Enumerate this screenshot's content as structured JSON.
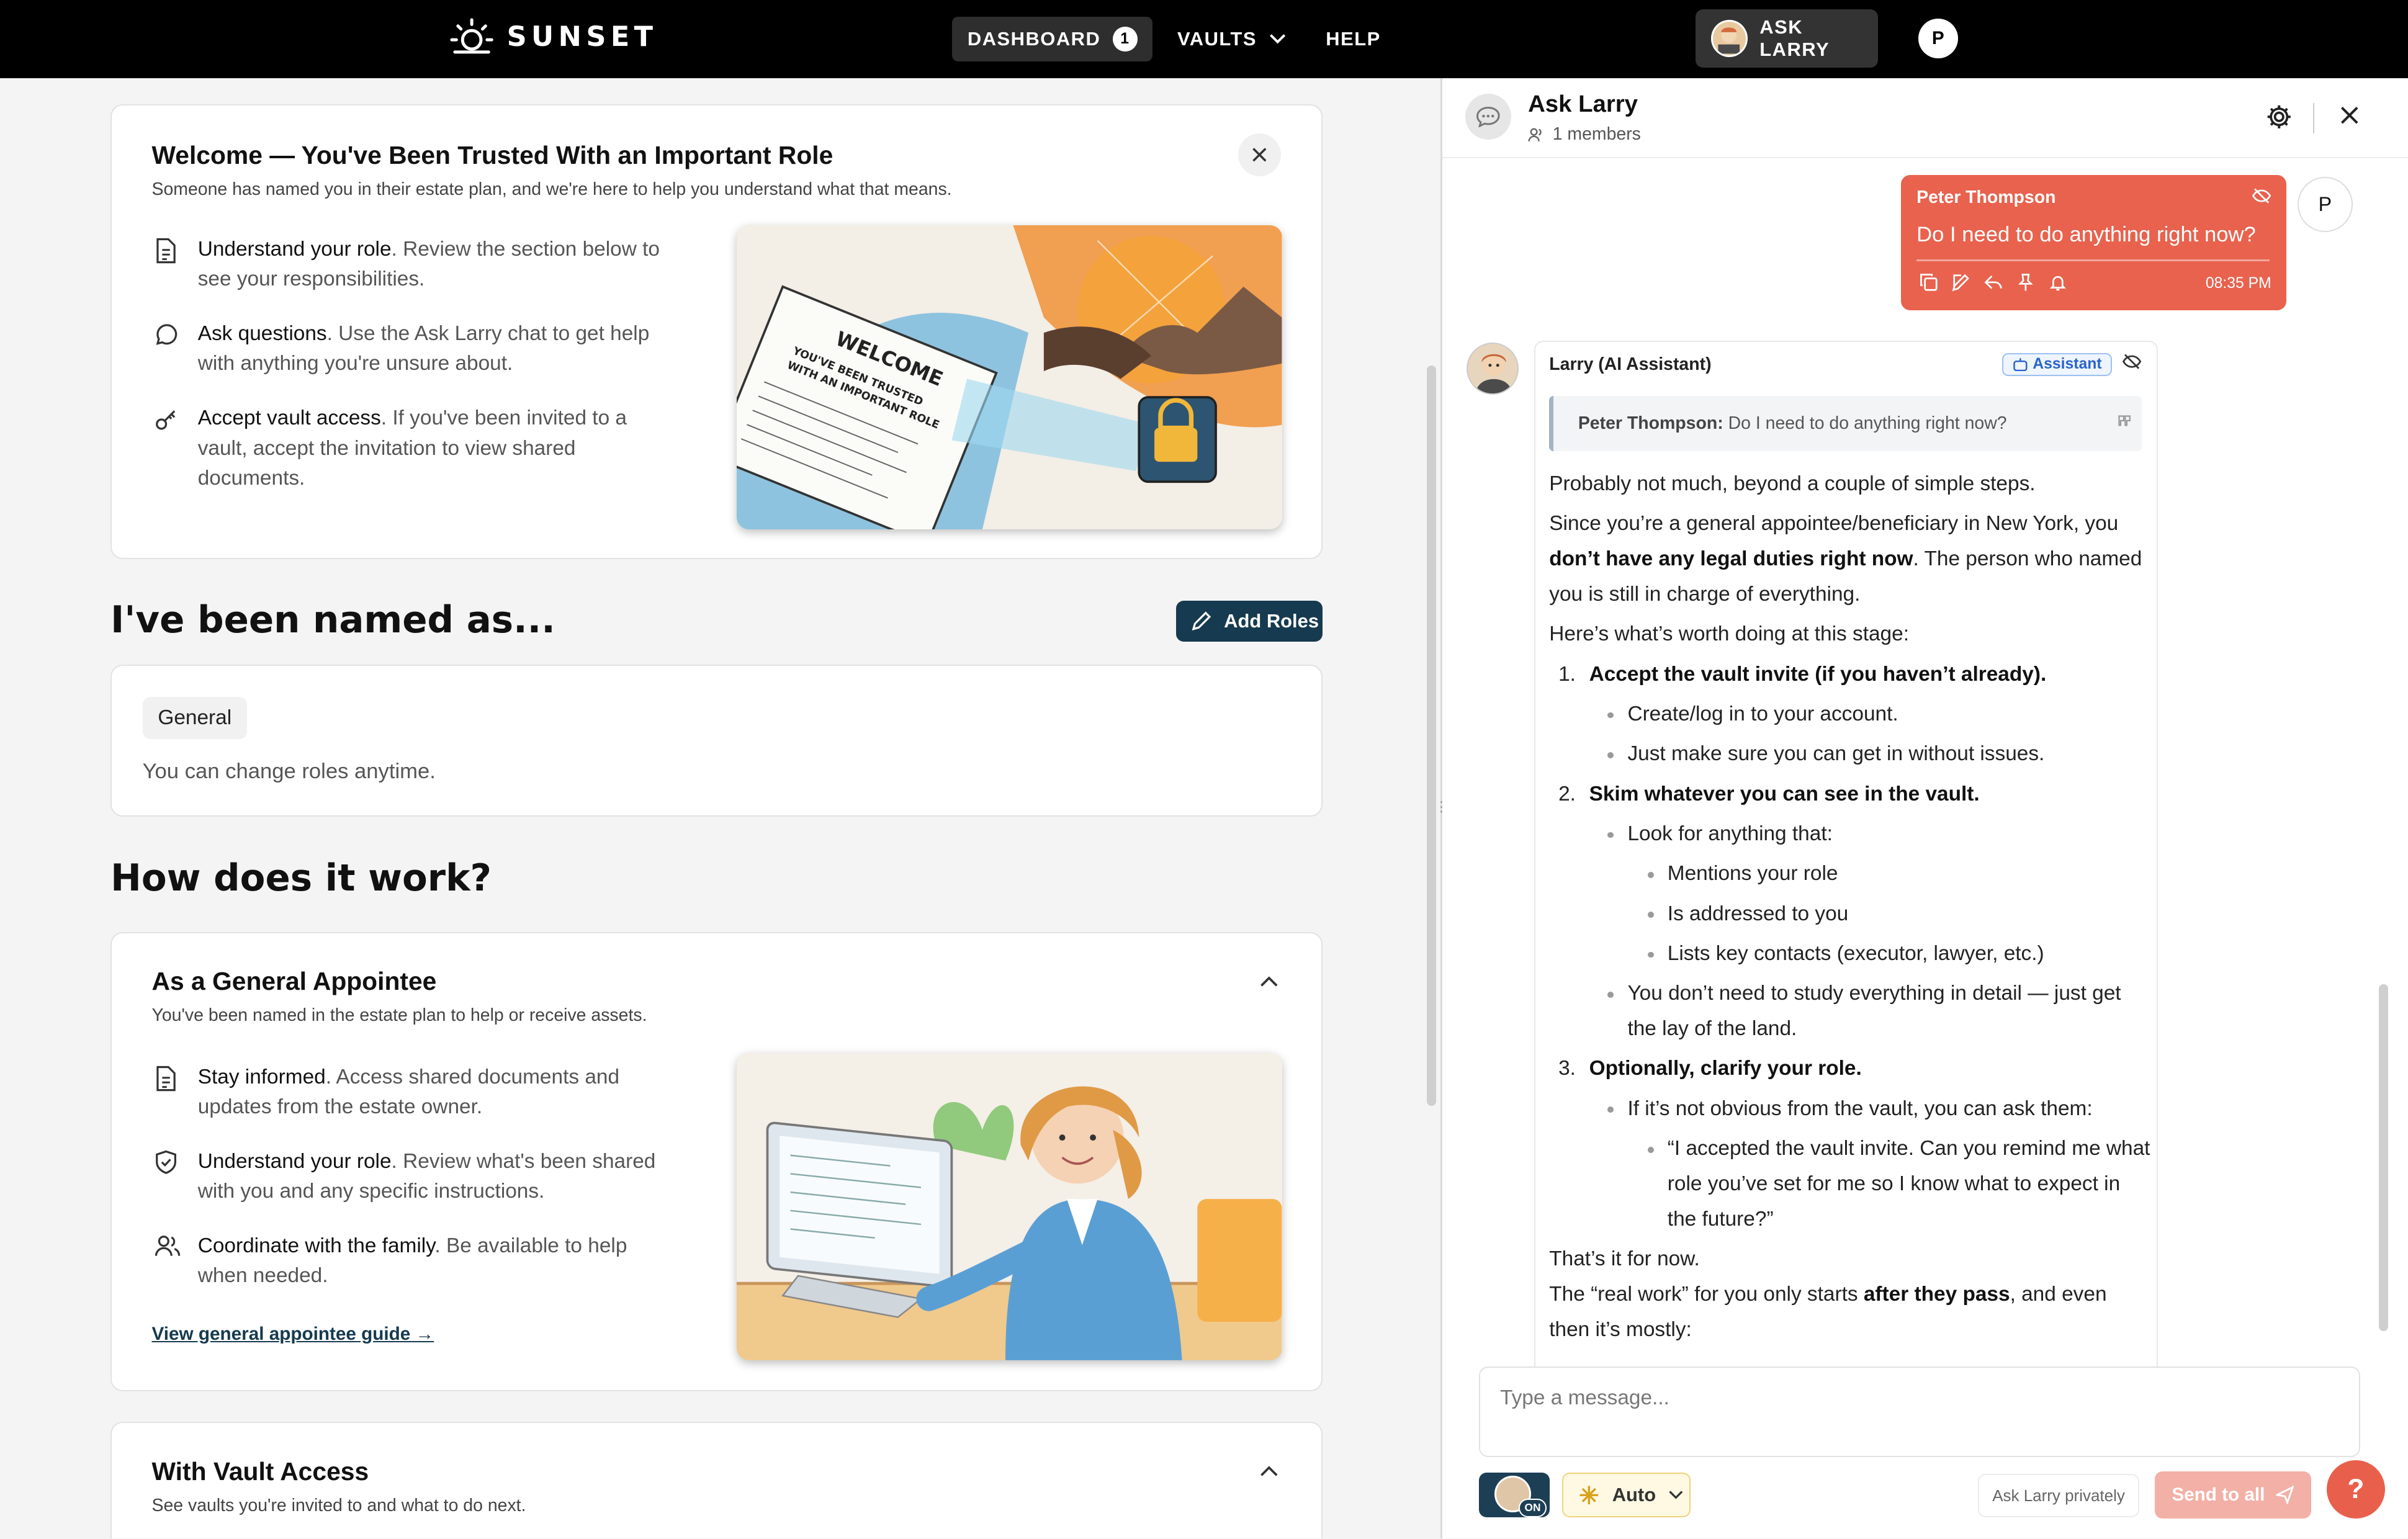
{
  "brand": {
    "name": "SUNSET"
  },
  "nav": {
    "dashboard": "DASHBOARD",
    "dashboard_count": "1",
    "vaults": "VAULTS",
    "help": "HELP",
    "ask_larry": "ASK LARRY",
    "user_initial": "P"
  },
  "welcome": {
    "title": "Welcome — You've Been Trusted With an Important Role",
    "subtitle": "Someone has named you in their estate plan, and we're here to help you understand what that means.",
    "items": [
      {
        "icon": "document-icon",
        "bold": "Understand your role",
        "text": ". Review the section below to see your responsibilities."
      },
      {
        "icon": "chat-bubble-icon",
        "bold": "Ask questions",
        "text": ". Use the Ask Larry chat to get help with anything you're unsure about."
      },
      {
        "icon": "key-icon",
        "bold": "Accept vault access",
        "text": ". If you've been invited to a vault, accept the invitation to view shared documents."
      }
    ]
  },
  "named": {
    "heading": "I've been named as...",
    "add_roles": "Add Roles",
    "role_tag": "General",
    "note": "You can change roles anytime."
  },
  "how": {
    "heading": "How does it work?",
    "general": {
      "title": "As a General Appointee",
      "subtitle": "You've been named in the estate plan to help or receive assets.",
      "items": [
        {
          "icon": "document-icon",
          "bold": "Stay informed",
          "text": ". Access shared documents and updates from the estate owner."
        },
        {
          "icon": "shield-check-icon",
          "bold": "Understand your role",
          "text": ". Review what's been shared with you and any specific instructions."
        },
        {
          "icon": "people-icon",
          "bold": "Coordinate with the family",
          "text": ". Be available to help when needed."
        }
      ],
      "link": "View general appointee guide →"
    },
    "vault": {
      "title": "With Vault Access",
      "subtitle": "See vaults you're invited to and what to do next."
    }
  },
  "chat": {
    "title": "Ask Larry",
    "members": "1 members",
    "user_msg": {
      "name": "Peter Thompson",
      "text": "Do I need to do anything right now?",
      "time": "08:35 PM",
      "avatar": "P"
    },
    "bot": {
      "name": "Larry (AI Assistant)",
      "badge": "Assistant",
      "quote_name": "Peter Thompson:",
      "quote_text": " Do I need to do anything right now?",
      "p1": "Probably not much, beyond a couple of simple steps.",
      "p2a": "Since you’re a general appointee/beneficiary in New York, you ",
      "p2b": "don’t have any legal duties right now",
      "p2c": ". The person who named you is still in charge of everything.",
      "p3": "Here’s what’s worth doing at this stage:",
      "s1": "Accept the vault invite (if you haven’t already).",
      "s1a": "Create/log in to your account.",
      "s1b": "Just make sure you can get in without issues.",
      "s2": "Skim whatever you can see in the vault.",
      "s2a": "Look for anything that:",
      "s2a1": "Mentions your role",
      "s2a2": "Is addressed to you",
      "s2a3": "Lists key contacts (executor, lawyer, etc.)",
      "s2b": "You don’t need to study everything in detail — just get the lay of the land.",
      "s3": "Optionally, clarify your role.",
      "s3a": "If it’s not obvious from the vault, you can ask them:",
      "s3a1": "“I accepted the vault invite. Can you remind me what role you’ve set for me so I know what to expect in the future?”",
      "p4": "That’s it for now.",
      "p5a": "The “real work” for you only starts ",
      "p5b": "after they pass",
      "p5c": ", and even then it’s mostly:"
    },
    "composer_placeholder": "Type a message...",
    "on_label": "ON",
    "mode": "Auto",
    "privately": "Ask Larry privately",
    "send_all": "Send to all",
    "help": "?"
  },
  "colors": {
    "accent": "#e8624e",
    "navy": "#163a4f",
    "topbar": "#000000"
  }
}
